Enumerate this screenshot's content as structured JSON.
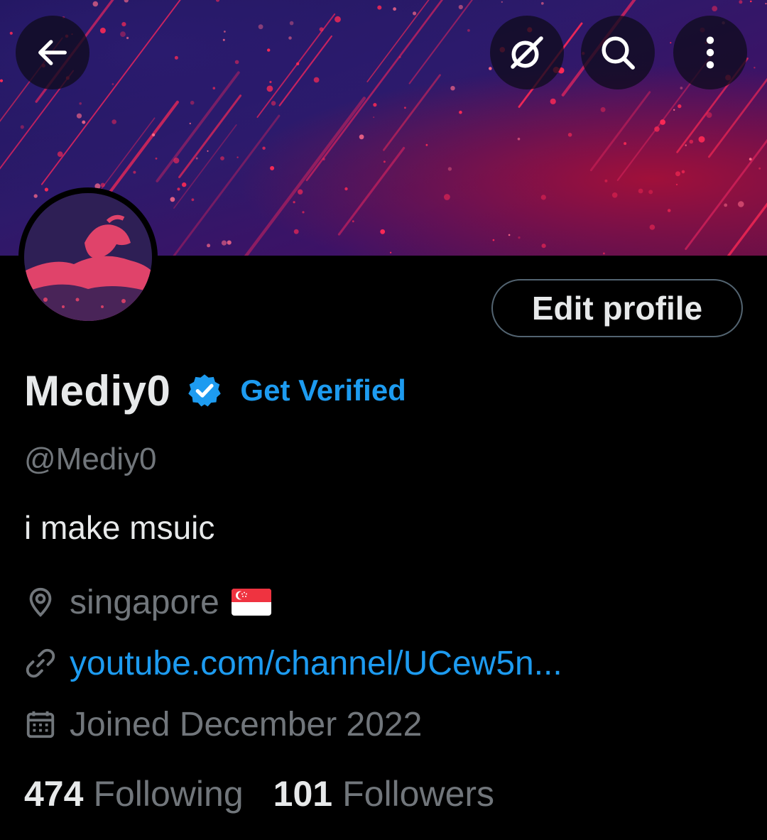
{
  "header": {
    "back_icon": "arrow-left-icon",
    "grok_icon": "grok-icon",
    "search_icon": "search-icon",
    "more_icon": "more-vertical-icon"
  },
  "profile": {
    "display_name": "Mediy0",
    "verified_icon": "verified-badge-icon",
    "get_verified_label": "Get Verified",
    "handle": "@Mediy0",
    "bio": "i make msuic",
    "location": "singapore",
    "location_flag": "singapore-flag",
    "website": "youtube.com/channel/UCew5n...",
    "joined": "Joined December 2022",
    "edit_profile_label": "Edit profile"
  },
  "stats": {
    "following_count": "474",
    "following_label": "Following",
    "followers_count": "101",
    "followers_label": "Followers"
  },
  "colors": {
    "accent": "#1d9bf0",
    "background": "#000000",
    "text_primary": "#e7e9ea",
    "text_secondary": "#71767b",
    "border": "#536471"
  }
}
